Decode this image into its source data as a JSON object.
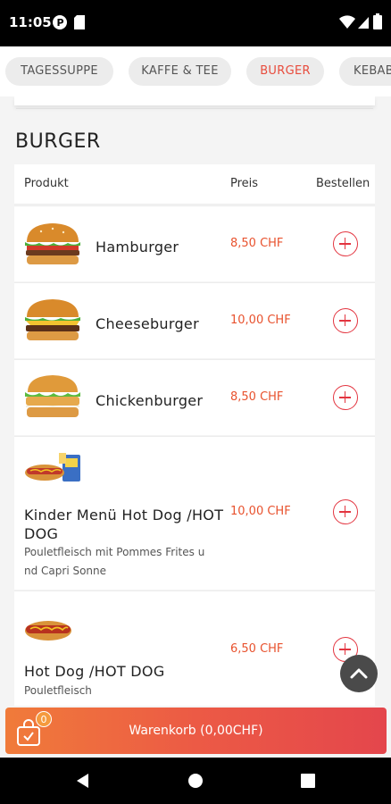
{
  "status_bar": {
    "time": "11:05"
  },
  "tabs": [
    {
      "label": "TAGESSUPPE",
      "active": false
    },
    {
      "label": "KAFFE & TEE",
      "active": false
    },
    {
      "label": "BURGER",
      "active": true
    },
    {
      "label": "KEBAB",
      "active": false
    }
  ],
  "section": {
    "title": "BURGER"
  },
  "table": {
    "headers": {
      "product": "Produkt",
      "price": "Preis",
      "order": "Bestellen"
    },
    "rows": [
      {
        "name": "Hamburger",
        "price": "8,50 CHF",
        "image": "hamburger-image"
      },
      {
        "name": "Cheeseburger",
        "price": "10,00 CHF",
        "image": "cheeseburger-image"
      },
      {
        "name": "Chickenburger",
        "price": "8,50 CHF",
        "image": "chickenburger-image"
      },
      {
        "name_line1": "Kinder Menü Hot Dog /HOT",
        "name_line2": "DOG",
        "price": "10,00 CHF",
        "desc_line1": "Pouletfleisch mit Pommes Frites u",
        "desc_line2": "nd Capri Sonne",
        "image": "kids-menu-hotdog-image"
      },
      {
        "name": "Hot Dog /HOT DOG",
        "price": "6,50 CHF",
        "desc": "Pouletfleisch",
        "image": "hotdog-image"
      }
    ]
  },
  "cart": {
    "label": "Warenkorb (0,00CHF)",
    "badge": "0"
  },
  "icons": {
    "add": "plus-circle-icon",
    "scroll_top": "chevron-up-icon",
    "cart": "shopping-bag-icon"
  },
  "colors": {
    "accent": "#e84c3d",
    "price": "#e8522e",
    "cart_start": "#f07b3a",
    "cart_end": "#e4464c"
  }
}
